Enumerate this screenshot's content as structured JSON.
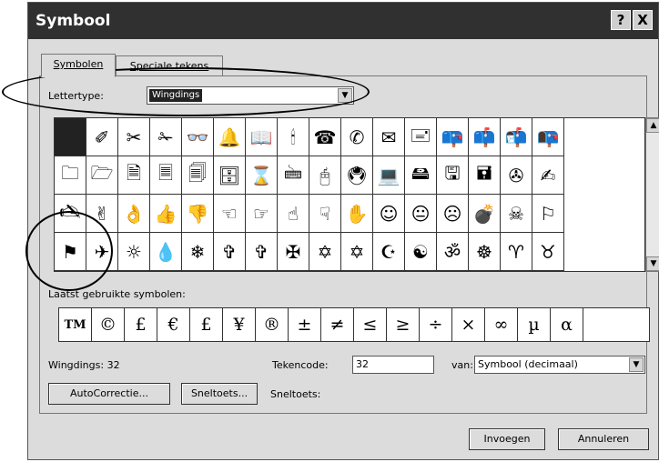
{
  "dialog": {
    "title": "Symbool",
    "help_label": "?",
    "close_label": "X"
  },
  "tabs": [
    {
      "label": "Symbolen",
      "active": true
    },
    {
      "label": "Speciale tekens",
      "active": false
    }
  ],
  "font": {
    "label": "Lettertype:",
    "value": "Wingdings"
  },
  "symbol_grid": {
    "rows": [
      [
        "",
        "✐",
        "✂",
        "✁",
        "👓",
        "🔔",
        "📖",
        "🕯",
        "☎",
        "✆",
        "✉",
        "🖃",
        "📪",
        "📫",
        "📬",
        "📭"
      ],
      [
        "🗀",
        "🗁",
        "🗎",
        "🗏",
        "🗐",
        "🗄",
        "⌛",
        "🖮",
        "🖰",
        "🖲",
        "💻",
        "🖴",
        "🖫",
        "🖬",
        "✇",
        "✍"
      ],
      [
        "🖎",
        "✌",
        "👌",
        "👍",
        "👎",
        "☜",
        "☞",
        "☝",
        "☟",
        "✋",
        "☺",
        "😐",
        "☹",
        "💣",
        "☠",
        "⚐"
      ],
      [
        "⚑",
        "✈",
        "☼",
        "💧",
        "❄",
        "✞",
        "✞",
        "✠",
        "✡",
        "✡",
        "☪",
        "☯",
        "ॐ",
        "☸",
        "♈",
        "♉"
      ]
    ],
    "selected": "0,0"
  },
  "recent": {
    "label": "Laatst gebruikte symbolen:",
    "symbols": [
      "TM",
      "©",
      "£",
      "€",
      "£",
      "¥",
      "®",
      "±",
      "≠",
      "≤",
      "≥",
      "÷",
      "×",
      "∞",
      "µ",
      "α"
    ]
  },
  "status": {
    "char_name": "Wingdings: 32",
    "code_label": "Tekencode:",
    "code_value": "32",
    "from_label": "van:",
    "from_value": "Symbool (decimaal)"
  },
  "buttons": {
    "autocorrect": "AutoCorrectie...",
    "shortcut_key": "Sneltoets...",
    "shortcut_label": "Sneltoets:",
    "insert": "Invoegen",
    "cancel": "Annuleren"
  },
  "icons": {
    "dropdown": "chevron-down-icon",
    "scroll_up": "arrow-up-icon",
    "scroll_down": "arrow-down-icon"
  },
  "colors": {
    "titlebar": "#303030",
    "dialog_bg": "#dcdcdc",
    "selection": "#222222"
  }
}
